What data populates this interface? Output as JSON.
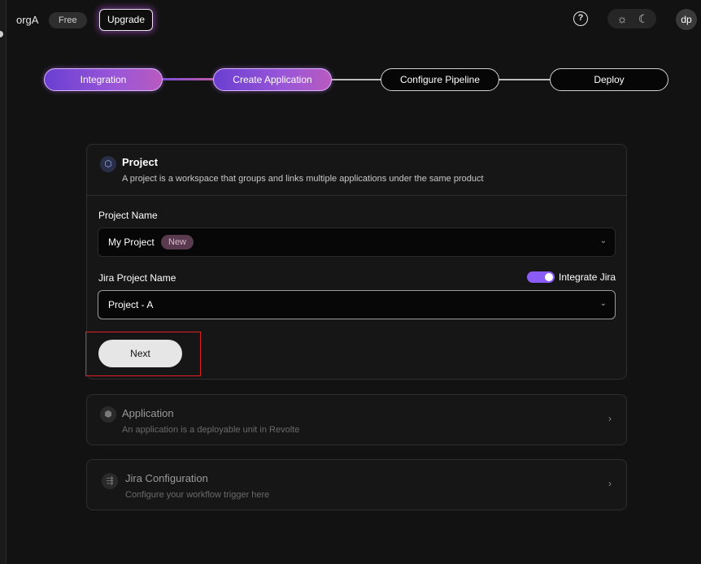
{
  "topbar": {
    "org_name": "orgA",
    "plan_badge": "Free",
    "upgrade_label": "Upgrade",
    "help_icon": "?",
    "sun_icon": "☼",
    "moon_icon": "☾",
    "avatar_initials": "dp"
  },
  "stepper": {
    "steps": [
      {
        "label": "Integration",
        "state": "completed"
      },
      {
        "label": "Create Application",
        "state": "current"
      },
      {
        "label": "Configure Pipeline",
        "state": "pending"
      },
      {
        "label": "Deploy",
        "state": "pending"
      }
    ]
  },
  "project_card": {
    "icon": "⬡",
    "title": "Project",
    "description": "A project is a workspace that groups and links multiple applications under the same product",
    "project_name_label": "Project Name",
    "project_name_value": "My Project",
    "new_badge": "New",
    "jira_project_label": "Jira Project Name",
    "integrate_jira_label": "Integrate Jira",
    "integrate_jira_on": true,
    "jira_project_value": "Project - A",
    "next_label": "Next",
    "chevron_down": "⌄"
  },
  "application_card": {
    "icon": "⬢",
    "title": "Application",
    "description": "An application is a deployable unit in Revolte",
    "chevron": "›"
  },
  "jira_card": {
    "icon": "⇶",
    "title": "Jira Configuration",
    "description": "Configure your workflow trigger here",
    "chevron": "›"
  },
  "colors": {
    "background": "#121212",
    "accent": "#8a5cf5",
    "highlight": "#e02020"
  }
}
